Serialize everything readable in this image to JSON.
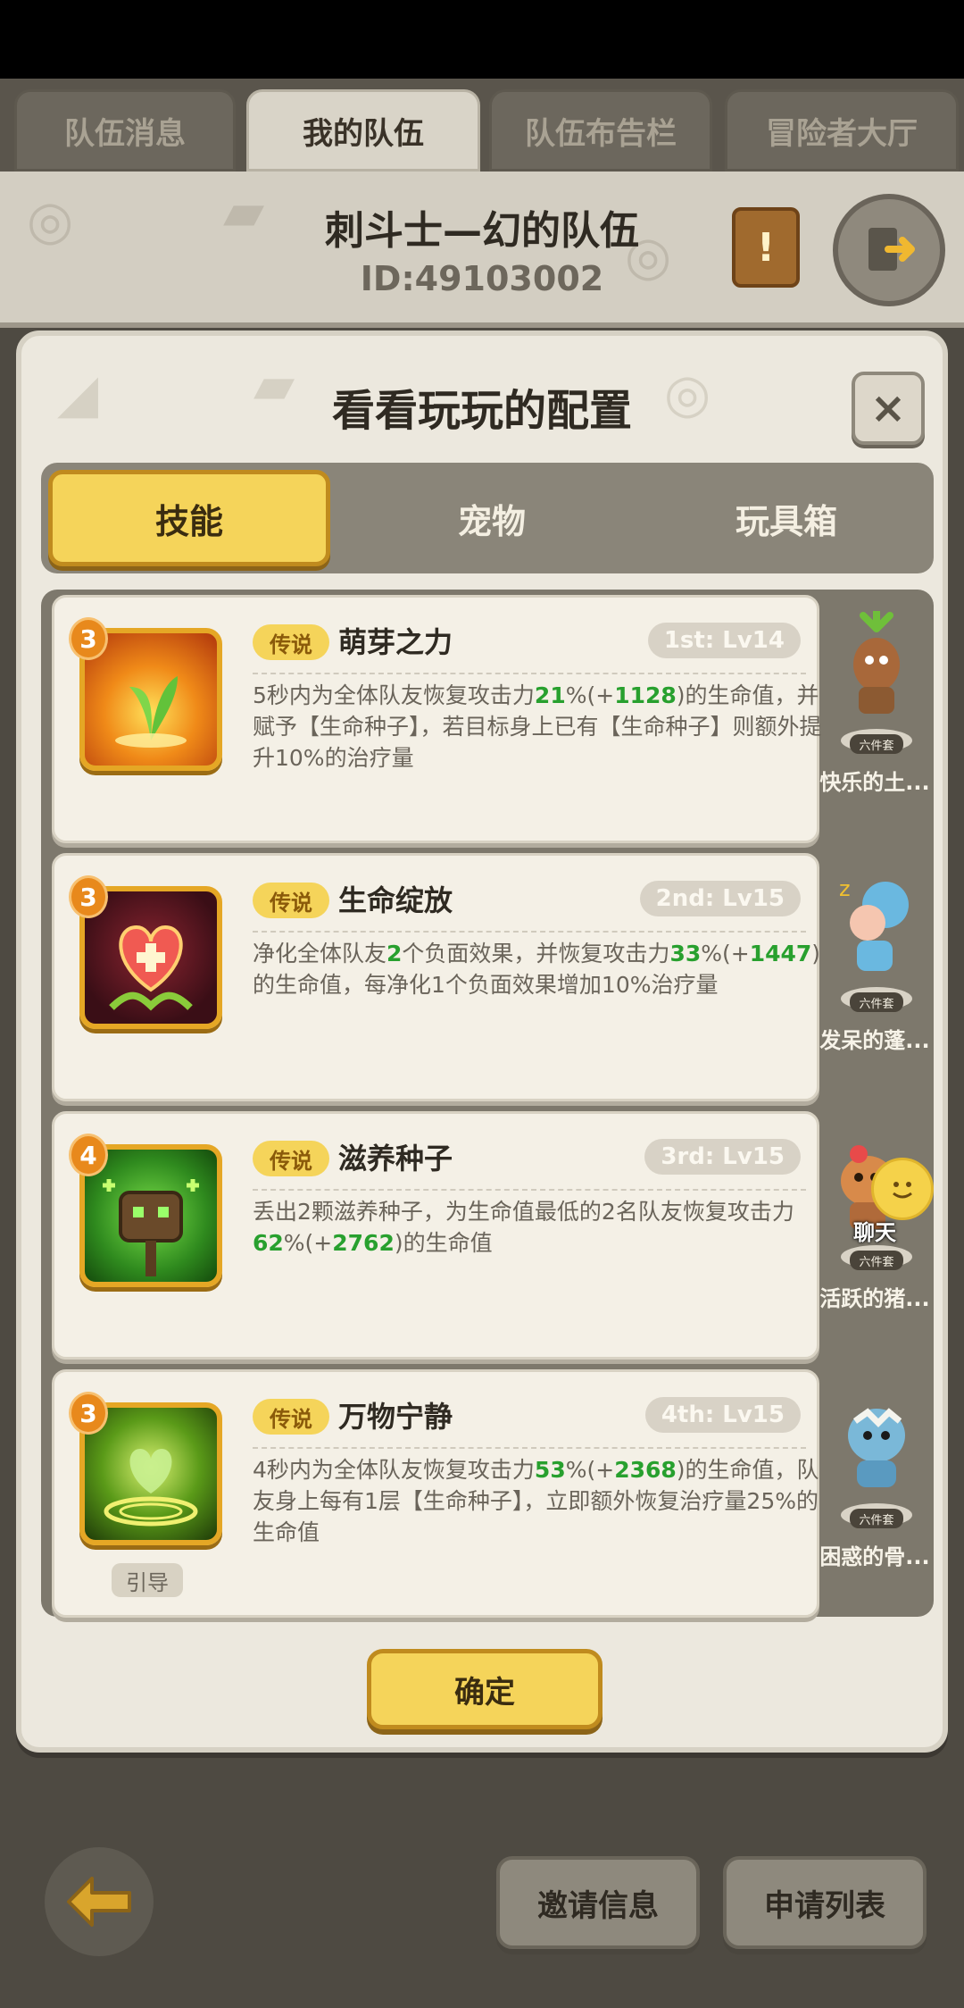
{
  "top_tabs": [
    {
      "label": "队伍消息",
      "active": false
    },
    {
      "label": "我的队伍",
      "active": true
    },
    {
      "label": "队伍布告栏",
      "active": false
    },
    {
      "label": "冒险者大厅",
      "active": false
    }
  ],
  "team": {
    "title": "刺斗士—幻的队伍",
    "id": "ID:49103002"
  },
  "modal": {
    "title": "看看玩玩的配置",
    "close_label": "×",
    "tabs": [
      {
        "label": "技能",
        "active": true
      },
      {
        "label": "宠物",
        "active": false
      },
      {
        "label": "玩具箱",
        "active": false
      }
    ],
    "skills": [
      {
        "stars": "3",
        "rarity": "传说",
        "name": "萌芽之力",
        "level": "1st: Lv14",
        "desc_parts": [
          "5秒内为全体队友恢复攻击力",
          "21",
          "%(+",
          "1128",
          ")的生命值，并赋予【生命种子】，若目标身上已有【生命种子】则额外提升10%的治疗量"
        ],
        "guide": ""
      },
      {
        "stars": "3",
        "rarity": "传说",
        "name": "生命绽放",
        "level": "2nd: Lv15",
        "desc_parts": [
          "净化全体队友",
          "2",
          "个负面效果，并恢复攻击力",
          "33",
          "%(+",
          "1447",
          ")的生命值，每净化1个负面效果增加10%治疗量"
        ],
        "guide": ""
      },
      {
        "stars": "4",
        "rarity": "传说",
        "name": "滋养种子",
        "level": "3rd: Lv15",
        "desc_parts": [
          "丢出2颗滋养种子，为生命值最低的2名队友恢复攻击力",
          "62",
          "%(+",
          "2762",
          ")的生命值"
        ],
        "guide": ""
      },
      {
        "stars": "3",
        "rarity": "传说",
        "name": "万物宁静",
        "level": "4th: Lv15",
        "desc_parts": [
          "4秒内为全体队友恢复攻击力",
          "53",
          "%(+",
          "2368",
          ")的生命值，队友身上每有1层【生命种子】，立即额外恢复治疗量25%的生命值"
        ],
        "guide": "引导"
      }
    ],
    "pets": [
      {
        "name": "快乐的土...",
        "set_tag": "六件套"
      },
      {
        "name": "发呆的蓬...",
        "set_tag": "六件套"
      },
      {
        "name": "活跃的猪...",
        "set_tag": "六件套"
      },
      {
        "name": "困惑的骨...",
        "set_tag": "六件套"
      }
    ],
    "chat_label": "聊天",
    "confirm_label": "确定"
  },
  "bottom": {
    "invite_label": "邀请信息",
    "apply_label": "申请列表"
  },
  "colors": {
    "accent": "#f5d45a",
    "highlight": "#28a02e",
    "panel": "#ece8de"
  }
}
